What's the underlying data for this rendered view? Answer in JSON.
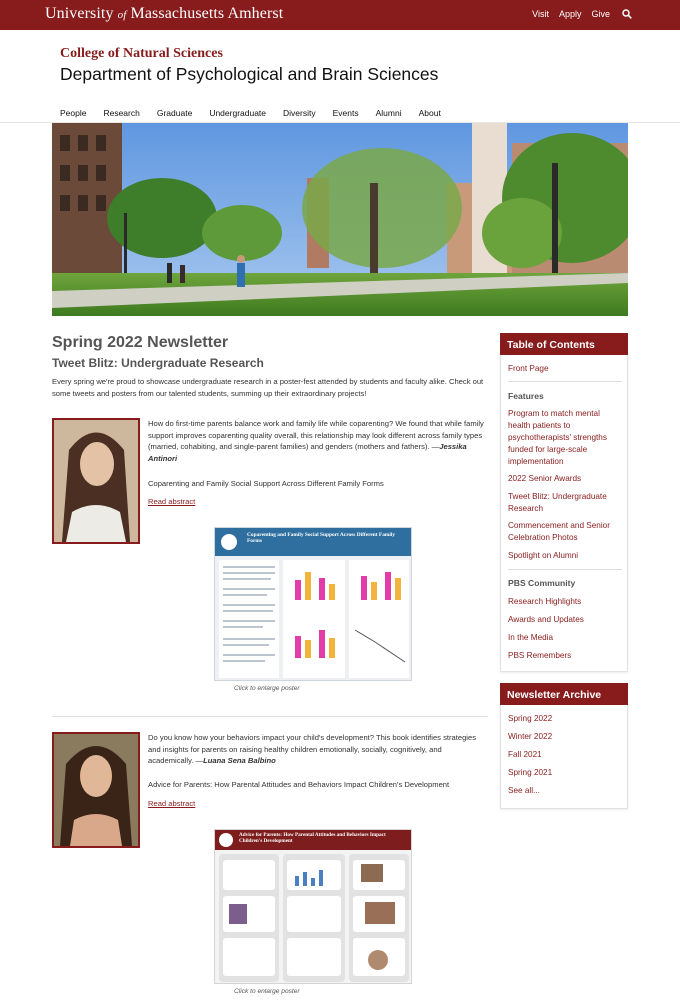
{
  "topbar": {
    "brand_left": "University",
    "brand_of": "of",
    "brand_right": "Massachusetts Amherst",
    "links": [
      "Visit",
      "Apply",
      "Give"
    ],
    "search_icon": "search-icon"
  },
  "header": {
    "college": "College of Natural Sciences",
    "department": "Department of Psychological and Brain Sciences"
  },
  "nav": {
    "items": [
      "People",
      "Research",
      "Graduate",
      "Undergraduate",
      "Diversity",
      "Events",
      "Alumni",
      "About"
    ]
  },
  "main": {
    "title": "Spring 2022 Newsletter",
    "subtitle": "Tweet Blitz: Undergraduate Research",
    "intro": "Every spring we're proud to showcase undergraduate research in a poster-fest attended by students and faculty alike. Check out some tweets and posters from our talented students, summing up their extraordinary projects!",
    "articles": [
      {
        "body": "How do first-time parents balance work and family life while coparenting? We found that while family support improves coparenting quality overall, this relationship may look different across family types (married, cohabiting, and single-parent families) and genders (mothers and fathers). —",
        "author": "Jessika Antinori",
        "poster_title": "Coparenting and Family Social Support Across Different Family Forms",
        "read_link": "Read abstract",
        "caption": "Click to enlarge poster",
        "poster_heading": "Coparenting and Family Social Support Across Different Family Forms"
      },
      {
        "body": "Do you know how your behaviors impact your child's development? This book identifies strategies and insights for parents on raising healthy children emotionally, socially, cognitively, and academically. —",
        "author": "Luana Sena Balbino",
        "poster_title": "Advice for Parents: How Parental Attitudes and Behaviors Impact Children's Development",
        "read_link": "Read abstract",
        "caption": "Click to enlarge poster",
        "poster_heading": "Advice for Parents: How Parental Attitudes and Behaviors Impact Children's Development"
      }
    ]
  },
  "sidebar": {
    "toc_title": "Table of Contents",
    "front_page": "Front Page",
    "features_label": "Features",
    "features": [
      "Program to match mental health patients to psychotherapists' strengths funded for large-scale implementation",
      "2022 Senior Awards",
      "Tweet Blitz: Undergraduate Research",
      "Commencement and Senior Celebration Photos",
      "Spotlight on Alumni"
    ],
    "community_label": "PBS Community",
    "community": [
      "Research Highlights",
      "Awards and Updates",
      "In the Media",
      "PBS Remembers"
    ],
    "archive_title": "Newsletter Archive",
    "archive": [
      "Spring 2022",
      "Winter 2022",
      "Fall 2021",
      "Spring 2021",
      "See all..."
    ]
  },
  "colors": {
    "brand": "#881c1c",
    "heading_gray": "#555555"
  }
}
